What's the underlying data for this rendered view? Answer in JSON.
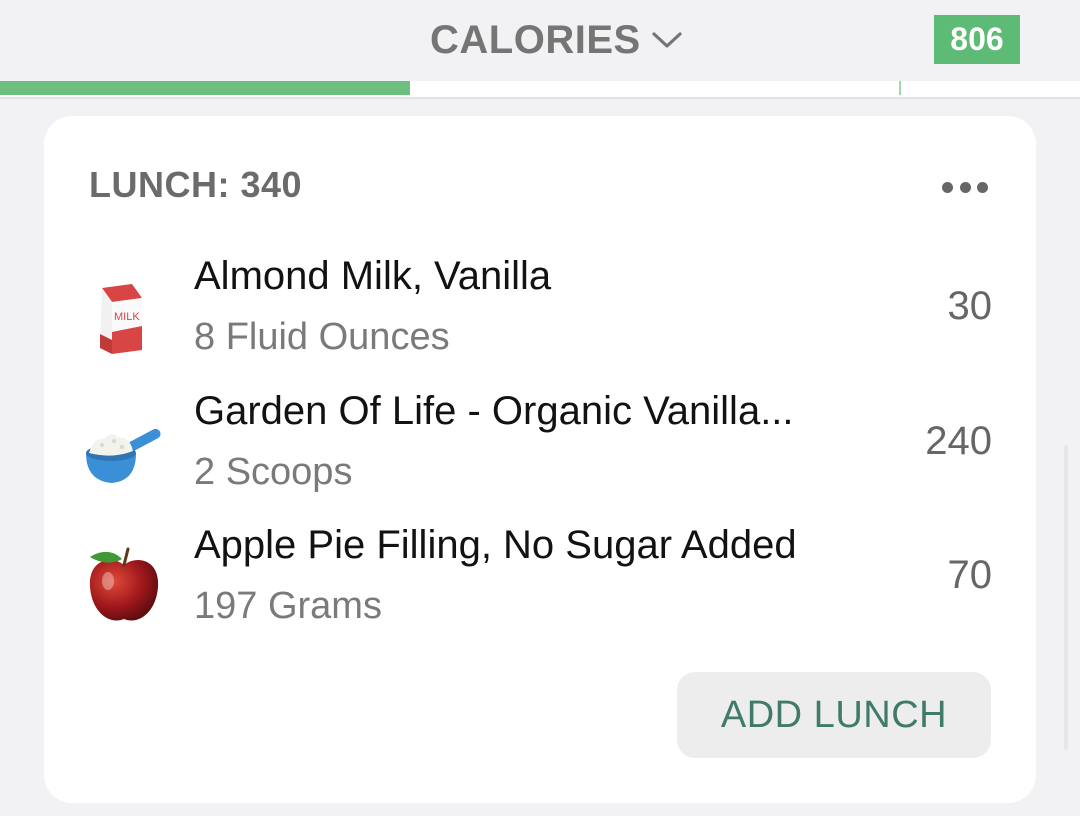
{
  "header": {
    "metric_label": "CALORIES",
    "calories_remaining": "806",
    "daily_progress": 0.38
  },
  "colors": {
    "accent_green": "#5dbb75",
    "button_text": "#3f7a6b"
  },
  "meal": {
    "title": "LUNCH: 340",
    "more_icon": "more-horizontal-icon",
    "items": [
      {
        "icon": "milk-carton-icon",
        "name": "Almond Milk, Vanilla",
        "serving": "8 Fluid Ounces",
        "calories": "30"
      },
      {
        "icon": "scoop-icon",
        "name": "Garden Of Life - Organic Vanilla...",
        "serving": "2 Scoops",
        "calories": "240"
      },
      {
        "icon": "apple-icon",
        "name": "Apple Pie Filling, No Sugar Added",
        "serving": "197 Grams",
        "calories": "70"
      }
    ],
    "add_button": "ADD LUNCH",
    "milk_carton_text": "MILK"
  }
}
